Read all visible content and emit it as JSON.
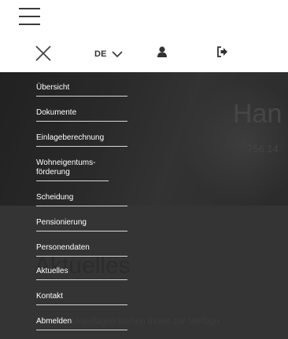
{
  "header": {
    "menu_icon": "hamburger-icon"
  },
  "menubar": {
    "close_icon": "close-icon",
    "language": "DE",
    "language_chevron_icon": "chevron-down-icon",
    "user_icon": "user-icon",
    "logout_icon": "logout-icon"
  },
  "hero": {
    "name": "Han",
    "number": "756.14"
  },
  "content": {
    "title": "Aktuelles",
    "text": "neue Unterlagen stehen Ihnen zur Verfügu"
  },
  "nav": {
    "items": [
      {
        "label": "Übersicht"
      },
      {
        "label": "Dokumente"
      },
      {
        "label": "Einlageberechnung"
      },
      {
        "label": "Wohneigentums-förderung"
      },
      {
        "label": "Scheidung"
      },
      {
        "label": "Pensionierung"
      },
      {
        "label": "Personendaten"
      },
      {
        "label": "Aktuelles"
      },
      {
        "label": "Kontakt"
      },
      {
        "label": "Abmelden"
      }
    ]
  },
  "colors": {
    "overlay": "#4a4a4a",
    "nav_text": "#ffffff",
    "nav_divider": "#d8d8d8",
    "icon": "#333333"
  }
}
